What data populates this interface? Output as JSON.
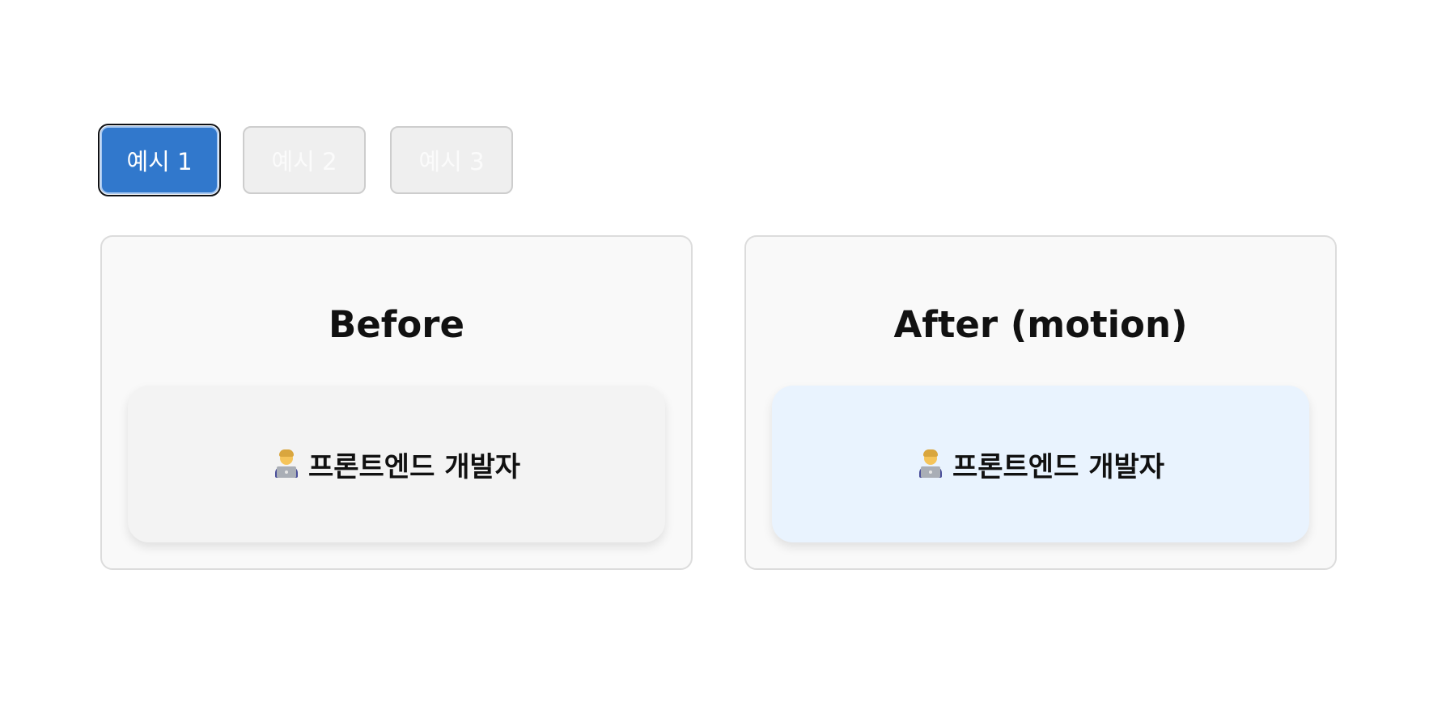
{
  "tabs": [
    {
      "label": "예시 1",
      "active": true
    },
    {
      "label": "예시 2",
      "active": false
    },
    {
      "label": "예시 3",
      "active": false
    }
  ],
  "panels": {
    "before": {
      "title": "Before",
      "card": {
        "icon": "technologist-icon",
        "label": "프론트엔드 개발자"
      }
    },
    "after": {
      "title": "After (motion)",
      "card": {
        "icon": "technologist-icon",
        "label": "프론트엔드 개발자"
      }
    }
  },
  "colors": {
    "active_tab": "#3178cc",
    "inactive_tab": "#efefef",
    "before_card": "#f3f3f3",
    "after_card": "#e9f3fe"
  }
}
